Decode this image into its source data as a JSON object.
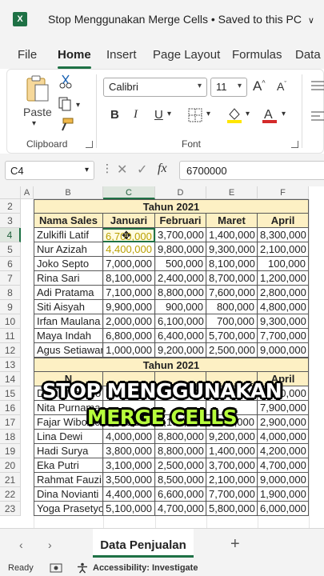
{
  "window": {
    "app_icon": "X",
    "title": "Stop Menggunakan Merge Cells • Saved to this PC",
    "title_chevron": "∨"
  },
  "tabs": [
    "File",
    "Home",
    "Insert",
    "Page Layout",
    "Formulas",
    "Data"
  ],
  "ribbon": {
    "paste_label": "Paste",
    "clipboard_label": "Clipboard",
    "font_name": "Calibri",
    "font_size": "11",
    "font_label": "Font",
    "bold": "B",
    "italic": "I",
    "underline": "U"
  },
  "formula_bar": {
    "name_box": "C4",
    "fx": "fx",
    "value": "6700000"
  },
  "columns": [
    "A",
    "B",
    "C",
    "D",
    "E",
    "F"
  ],
  "table1": {
    "title": "Tahun 2021",
    "headers": [
      "Nama Sales",
      "Januari",
      "Februari",
      "Maret",
      "April"
    ],
    "rows": [
      [
        "Zulkifli Latif",
        "6,700,000",
        "3,700,000",
        "1,400,000",
        "8,300,000"
      ],
      [
        "Nur Azizah",
        "4,400,000",
        "9,800,000",
        "9,300,000",
        "2,100,000"
      ],
      [
        "Joko Septo",
        "7,000,000",
        "500,000",
        "8,100,000",
        "100,000"
      ],
      [
        "Rina Sari",
        "8,100,000",
        "2,400,000",
        "8,700,000",
        "1,200,000"
      ],
      [
        "Adi Pratama",
        "7,100,000",
        "8,800,000",
        "7,600,000",
        "2,800,000"
      ],
      [
        "Siti Aisyah",
        "9,900,000",
        "900,000",
        "800,000",
        "4,800,000"
      ],
      [
        "Irfan Maulana",
        "2,000,000",
        "6,100,000",
        "700,000",
        "9,300,000"
      ],
      [
        "Maya Indah",
        "6,800,000",
        "6,400,000",
        "5,700,000",
        "7,700,000"
      ],
      [
        "Agus Setiawan",
        "1,000,000",
        "9,200,000",
        "2,500,000",
        "9,000,000"
      ]
    ]
  },
  "table2": {
    "title": "Tahun 2021",
    "headers": [
      "N",
      "",
      "",
      "",
      "April"
    ],
    "rows": [
      [
        "Dodi Nugroho",
        "7,700,000",
        "5,700,000",
        "5,300,000",
        "8,600,000"
      ],
      [
        "Nita Purnama",
        "",
        "",
        "",
        "7,900,000"
      ],
      [
        "Fajar Wibowo",
        "3,000,000",
        "6,100,000",
        "500,000",
        "2,900,000"
      ],
      [
        "Lina Dewi",
        "4,000,000",
        "8,800,000",
        "9,200,000",
        "4,000,000"
      ],
      [
        "Hadi Surya",
        "3,800,000",
        "8,800,000",
        "1,400,000",
        "4,200,000"
      ],
      [
        "Eka Putri",
        "3,100,000",
        "2,500,000",
        "3,700,000",
        "4,700,000"
      ],
      [
        "Rahmat Fauzi",
        "3,500,000",
        "8,500,000",
        "2,100,000",
        "9,000,000"
      ],
      [
        "Dina Novianti",
        "4,400,000",
        "6,600,000",
        "7,700,000",
        "1,900,000"
      ],
      [
        "Yoga Prasetyo",
        "5,100,000",
        "4,700,000",
        "5,800,000",
        "6,000,000"
      ]
    ]
  },
  "row_numbers": [
    "2",
    "3",
    "4",
    "5",
    "6",
    "7",
    "8",
    "9",
    "10",
    "11",
    "12",
    "13",
    "14",
    "15",
    "16",
    "17",
    "18",
    "19",
    "20",
    "21",
    "22",
    "23"
  ],
  "overlay": {
    "line1": "STOP MENGGUNAKAN",
    "line2": "MERGE CELLS"
  },
  "sheet_tabs": {
    "active": "Data Penjualan",
    "add": "+"
  },
  "status": {
    "ready": "Ready",
    "accessibility": "Accessibility: Investigate"
  },
  "colors": {
    "excel_green": "#1e7145",
    "header_fill": "#fdf0c4",
    "overlay_green": "#b7ff3b"
  }
}
